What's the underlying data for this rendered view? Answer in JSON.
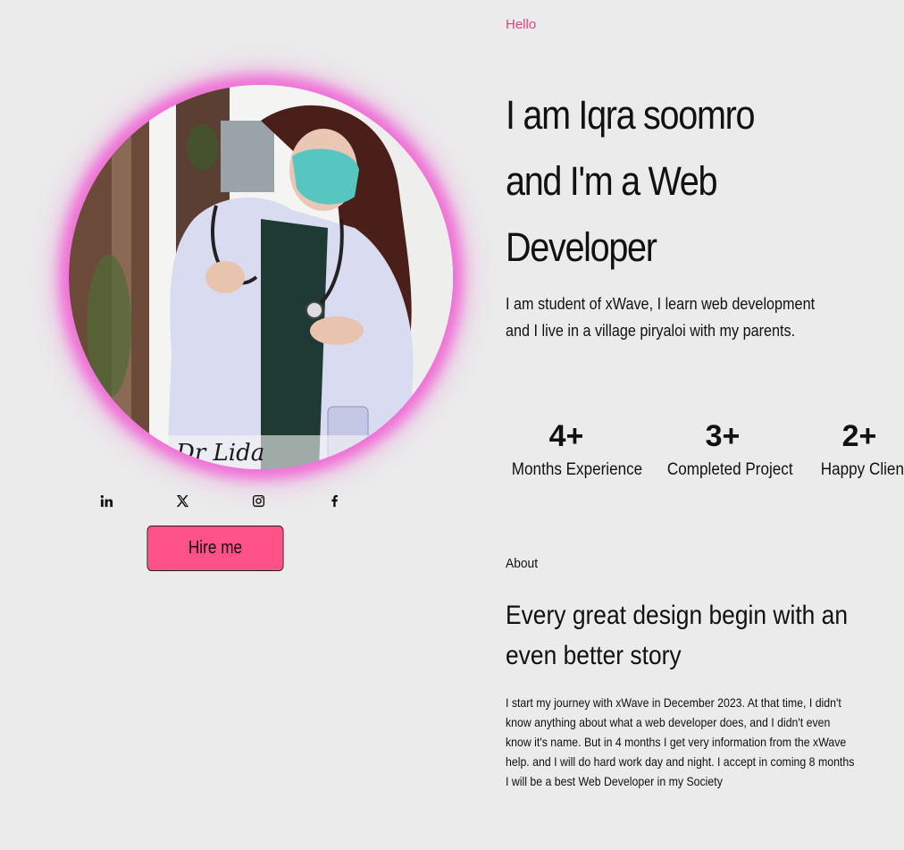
{
  "hero": {
    "greeting": "Hello",
    "headline_lines": [
      "I am Iqra soomro",
      "and I'm a Web",
      "Developer"
    ],
    "intro_lines": [
      "I am student of xWave, I learn web development",
      "and I live in a village piryaloi with my parents."
    ]
  },
  "profile": {
    "photo_signature": "Dr Lida",
    "ring_color": "#f06fd6"
  },
  "social": [
    {
      "icon": "linkedin-icon"
    },
    {
      "icon": "x-icon"
    },
    {
      "icon": "instagram-icon"
    },
    {
      "icon": "facebook-icon"
    }
  ],
  "hire_button": {
    "label": "Hire me",
    "color": "#ff5289"
  },
  "stats": [
    {
      "value": "4+",
      "label": "Months Experience"
    },
    {
      "value": "3+",
      "label": "Completed Project"
    },
    {
      "value": "2+",
      "label": "Happy Client"
    }
  ],
  "about": {
    "label": "About",
    "title_lines": [
      "Every great design begin with an",
      "even better story"
    ],
    "body_lines": [
      "I start my journey with xWave in December 2023. At that time, I didn't",
      "know anything about what a web developer does, and I didn't even",
      "know it's name. But in 4 months I get very information from the xWave",
      "help. and I will do hard work day and night. I accept in coming 8 months",
      "I will be a best Web Developer in my Society"
    ]
  },
  "colors": {
    "background": "#ebebeb",
    "accent": "#e2457b",
    "text": "#111111"
  }
}
